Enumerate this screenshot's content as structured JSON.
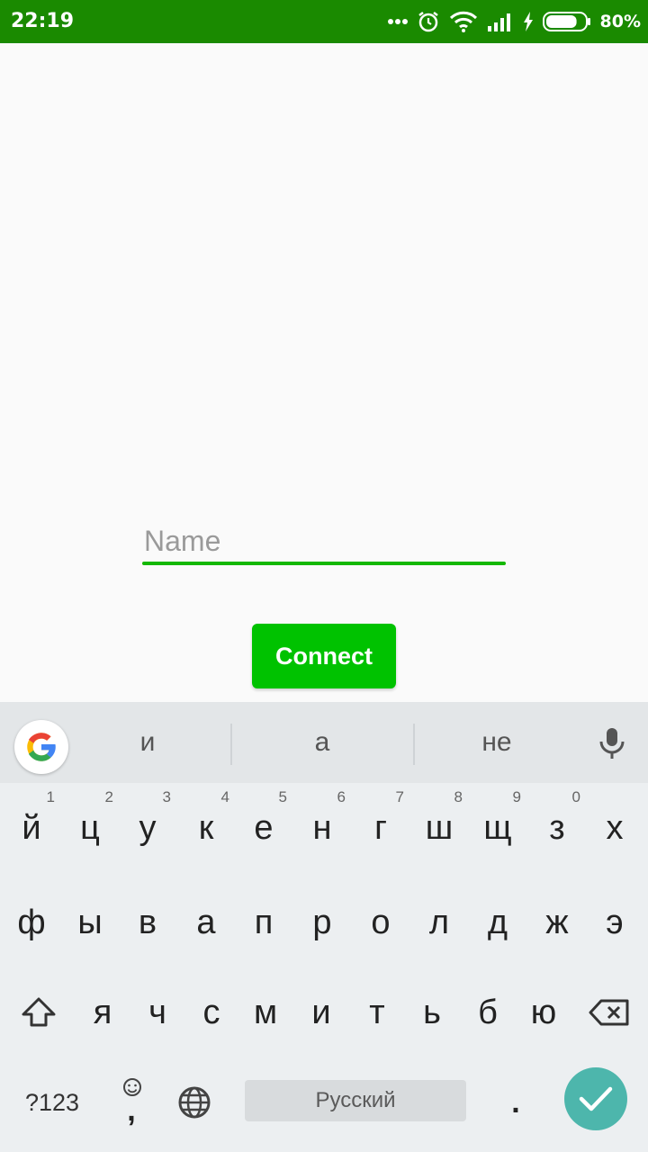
{
  "status_bar": {
    "time": "22:19",
    "battery_percent": "80%",
    "battery_level": 0.8,
    "background": "#1a8a00",
    "icons": [
      "more-dots-icon",
      "alarm-icon",
      "wifi-icon",
      "signal-icon",
      "charging-icon",
      "battery-icon"
    ]
  },
  "form": {
    "name_placeholder": "Name",
    "name_value": "",
    "connect_label": "Connect",
    "accent_color": "#00c200"
  },
  "keyboard": {
    "suggestions": [
      "и",
      "а",
      "не"
    ],
    "row1": [
      {
        "key": "й",
        "hint": "1"
      },
      {
        "key": "ц",
        "hint": "2"
      },
      {
        "key": "у",
        "hint": "3"
      },
      {
        "key": "к",
        "hint": "4"
      },
      {
        "key": "е",
        "hint": "5"
      },
      {
        "key": "н",
        "hint": "6"
      },
      {
        "key": "г",
        "hint": "7"
      },
      {
        "key": "ш",
        "hint": "8"
      },
      {
        "key": "щ",
        "hint": "9"
      },
      {
        "key": "з",
        "hint": "0"
      },
      {
        "key": "х",
        "hint": ""
      }
    ],
    "row2": [
      "ф",
      "ы",
      "в",
      "а",
      "п",
      "р",
      "о",
      "л",
      "д",
      "ж",
      "э"
    ],
    "row3": [
      "я",
      "ч",
      "с",
      "м",
      "и",
      "т",
      "ь",
      "б",
      "ю"
    ],
    "symbols_label": "?123",
    "comma_label": ",",
    "space_label": "Русский",
    "period_label": ".",
    "enter_color": "#4db6ac"
  }
}
